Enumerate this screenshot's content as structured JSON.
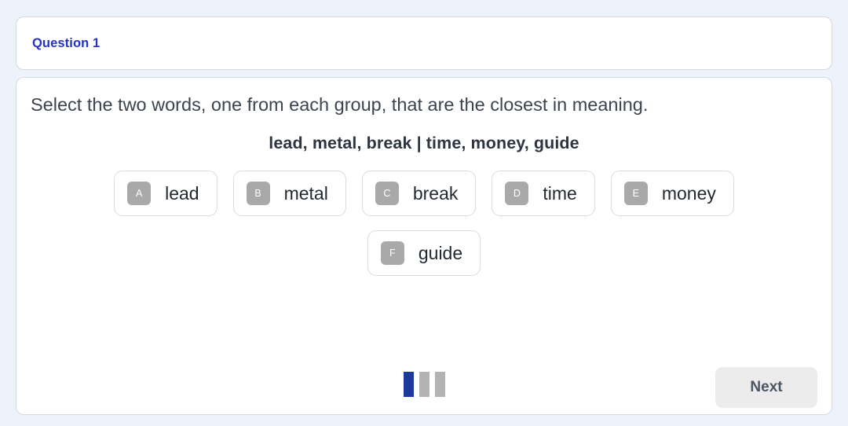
{
  "header": {
    "question_label": "Question 1",
    "accent_color": "#2433c6"
  },
  "quiz": {
    "prompt": "Select the two words, one from each group, that are the closest in meaning.",
    "word_groups": "lead, metal, break | time, money, guide",
    "options": [
      {
        "letter": "A",
        "word": "lead"
      },
      {
        "letter": "B",
        "word": "metal"
      },
      {
        "letter": "C",
        "word": "break"
      },
      {
        "letter": "D",
        "word": "time"
      },
      {
        "letter": "E",
        "word": "money"
      },
      {
        "letter": "F",
        "word": "guide"
      }
    ]
  },
  "footer": {
    "progress": {
      "total": 3,
      "current": 1,
      "active_color": "#1b3a9c",
      "inactive_color": "#b3b3b3"
    },
    "next_label": "Next"
  }
}
